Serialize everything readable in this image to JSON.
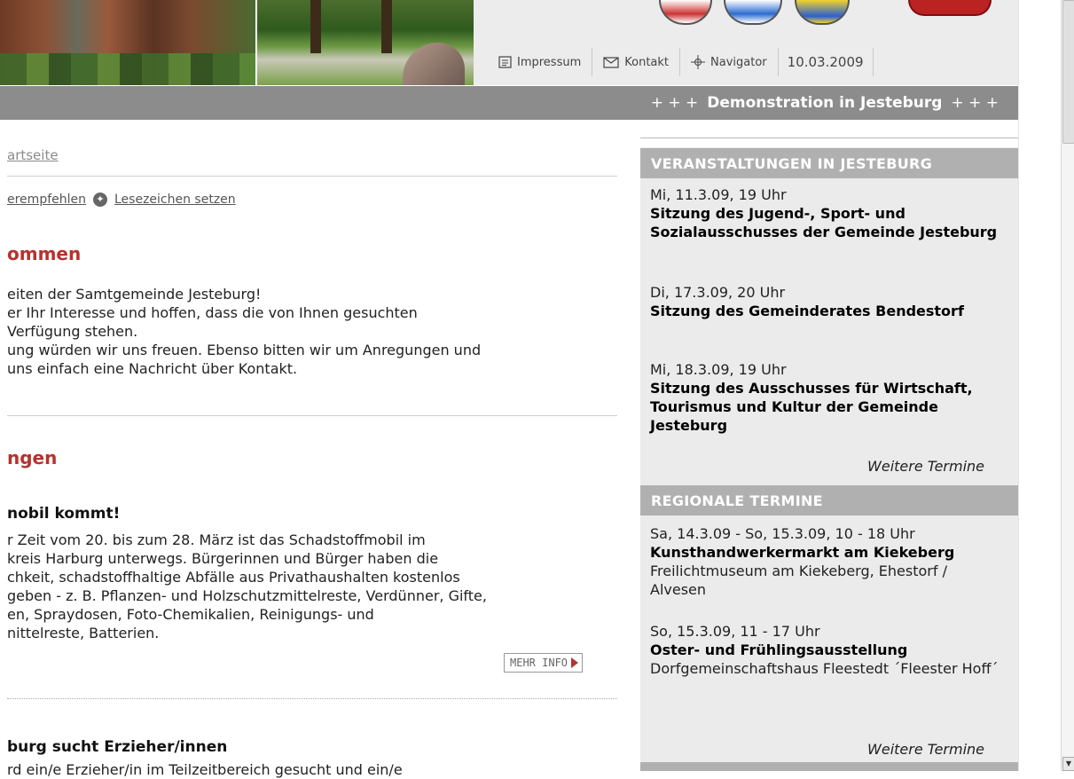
{
  "toolbar": {
    "impressum": "Impressum",
    "kontakt": "Kontakt",
    "navigator": "Navigator",
    "date": "10.03.2009"
  },
  "ticker": {
    "plus_left": "+ + +",
    "headline": "Demonstration in Jesteburg",
    "plus_right": "+ + +"
  },
  "main": {
    "breadcrumb": "artseite",
    "recommend_link": "erempfehlen",
    "bookmark_link": "Lesezeichen setzen",
    "welcome_heading": "ommen",
    "welcome_lines": [
      "eiten der Samtgemeinde Jesteburg!",
      "er Ihr Interesse und hoffen, dass die von Ihnen gesuchten",
      " Verfügung stehen.",
      "ung würden wir uns freuen. Ebenso bitten wir um Anregungen und",
      " uns einfach eine Nachricht über Kontakt."
    ],
    "news_heading": "ngen",
    "article1_title": "nobil kommt!",
    "article1_lines": [
      "r Zeit vom 20. bis zum 28. März ist das Schadstoffmobil im",
      "kreis Harburg unterwegs. Bürgerinnen und Bürger haben die",
      "chkeit, schadstoffhaltige Abfälle aus Privathaushalten kostenlos",
      "geben - z. B. Pflanzen- und Holzschutzmittelreste, Verdünner, Gifte,",
      "en, Spraydosen, Foto-Chemikalien, Reinigungs- und",
      "nittelreste, Batterien."
    ],
    "more_info": "MEHR INFO",
    "article2_title": "burg sucht Erzieher/innen",
    "article2_line": "rd ein/e Erzieher/in im Teilzeitbereich gesucht und ein/e"
  },
  "sidebar": {
    "events_heading": "VERANSTALTUNGEN IN JESTEBURG",
    "events": [
      {
        "date": "Mi, 11.3.09, 19 Uhr",
        "title": "Sitzung des Jugend-, Sport- und Sozialausschusses der Gemeinde Jesteburg"
      },
      {
        "date": "Di, 17.3.09, 20 Uhr",
        "title": "Sitzung des Gemeinderates Bendestorf"
      },
      {
        "date": "Mi, 18.3.09, 19 Uhr",
        "title": "Sitzung des Ausschusses für Wirtschaft, Tourismus und Kultur der Gemeinde Jesteburg"
      }
    ],
    "events_more": "Weitere Termine",
    "regional_heading": "REGIONALE TERMINE",
    "regional": [
      {
        "date": "Sa, 14.3.09 - So, 15.3.09, 10 - 18 Uhr",
        "title": "Kunsthandwerkermarkt am Kiekeberg",
        "location": "Freilichtmuseum am Kiekeberg, Ehestorf / Alvesen"
      },
      {
        "date": "So, 15.3.09, 11 - 17 Uhr",
        "title": "Oster- und Frühlingsausstellung",
        "location": "Dorfgemeinschaftshaus Fleestedt ´Fleester Hoff´"
      }
    ],
    "regional_more": "Weitere Termine"
  },
  "icons": {
    "impressum": "document-icon",
    "kontakt": "envelope-icon",
    "navigator": "crosshair-icon",
    "bookmark": "star-icon",
    "more_info": "arrow-right-icon"
  }
}
